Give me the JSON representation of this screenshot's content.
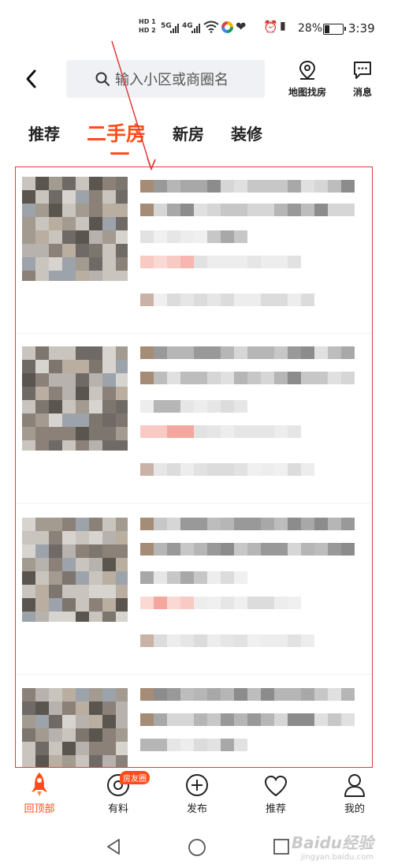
{
  "status_bar": {
    "net_top": "HD 1",
    "net_bottom": "HD 2",
    "sig1": "5G",
    "sig2": "4G",
    "battery": "28%",
    "time": "3:39",
    "icons": [
      "wifi-icon",
      "app-icon",
      "heart-icon",
      "alarm-icon",
      "vibrate-icon",
      "battery-icon"
    ]
  },
  "header": {
    "back_icon": "chevron-left-icon",
    "search_placeholder": "输入小区或商圈名",
    "map_label": "地图找房",
    "message_label": "消息"
  },
  "tabs": [
    {
      "label": "推荐",
      "active": false
    },
    {
      "label": "二手房",
      "active": true
    },
    {
      "label": "新房",
      "active": false
    },
    {
      "label": "装修",
      "active": false
    }
  ],
  "listings": [
    {
      "blurred": true
    },
    {
      "blurred": true
    },
    {
      "blurred": true
    },
    {
      "blurred": true
    }
  ],
  "bottom_nav": [
    {
      "label": "回顶部",
      "icon": "rocket-icon",
      "active": true
    },
    {
      "label": "有料",
      "icon": "target-icon",
      "badge": "房友圈",
      "active": false
    },
    {
      "label": "发布",
      "icon": "plus-circle-icon",
      "active": false
    },
    {
      "label": "推荐",
      "icon": "heart-icon",
      "active": false
    },
    {
      "label": "我的",
      "icon": "user-icon",
      "active": false
    }
  ],
  "watermark": {
    "main": "Baidu经验",
    "sub": "jingyan.baidu.com"
  },
  "colors": {
    "accent": "#ff4d1a",
    "annotation": "#e23b3b",
    "search_bg": "#f0f1f4"
  }
}
